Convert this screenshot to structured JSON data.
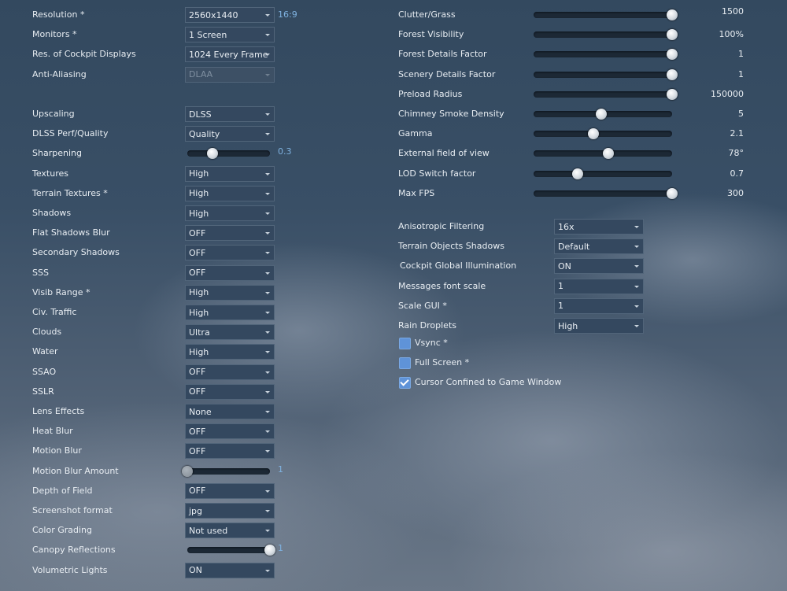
{
  "left": [
    {
      "label": "Resolution *",
      "type": "dropdown",
      "value": "2560x1440",
      "extra": "16:9"
    },
    {
      "label": "Monitors *",
      "type": "dropdown",
      "value": "1 Screen"
    },
    {
      "label": "Res. of Cockpit Displays",
      "type": "dropdown",
      "value": "1024 Every Frame"
    },
    {
      "label": "Anti-Aliasing",
      "type": "dropdown",
      "value": "DLAA",
      "disabled": true
    },
    {
      "type": "spacer"
    },
    {
      "label": "Upscaling",
      "type": "dropdown",
      "value": "DLSS"
    },
    {
      "label": "DLSS Perf/Quality",
      "type": "dropdown",
      "value": "Quality"
    },
    {
      "label": "Sharpening",
      "type": "slider",
      "value": "0.3",
      "fraction": 0.3
    },
    {
      "label": "Textures",
      "type": "dropdown",
      "value": "High"
    },
    {
      "label": "Terrain Textures *",
      "type": "dropdown",
      "value": "High"
    },
    {
      "label": "Shadows",
      "type": "dropdown",
      "value": "High"
    },
    {
      "label": "Flat Shadows Blur",
      "type": "dropdown",
      "value": "OFF"
    },
    {
      "label": "Secondary Shadows",
      "type": "dropdown",
      "value": "OFF"
    },
    {
      "label": "SSS",
      "type": "dropdown",
      "value": "OFF"
    },
    {
      "label": "Visib Range *",
      "type": "dropdown",
      "value": "High"
    },
    {
      "label": "Civ. Traffic",
      "type": "dropdown",
      "value": "High"
    },
    {
      "label": "Clouds",
      "type": "dropdown",
      "value": "Ultra"
    },
    {
      "label": "Water",
      "type": "dropdown",
      "value": "High"
    },
    {
      "label": "SSAO",
      "type": "dropdown",
      "value": "OFF"
    },
    {
      "label": "SSLR",
      "type": "dropdown",
      "value": "OFF"
    },
    {
      "label": "Lens Effects",
      "type": "dropdown",
      "value": "None"
    },
    {
      "label": "Heat Blur",
      "type": "dropdown",
      "value": "OFF"
    },
    {
      "label": "Motion Blur",
      "type": "dropdown",
      "value": "OFF"
    },
    {
      "label": "Motion Blur Amount",
      "type": "slider",
      "value": "1",
      "fraction": 0.0,
      "disabled": true
    },
    {
      "label": "Depth of Field",
      "type": "dropdown",
      "value": "OFF"
    },
    {
      "label": "Screenshot format",
      "type": "dropdown",
      "value": "jpg"
    },
    {
      "label": "Color Grading",
      "type": "dropdown",
      "value": "Not used"
    },
    {
      "label": "Canopy Reflections",
      "type": "slider",
      "value": "1",
      "fraction": 1.0
    },
    {
      "label": "Volumetric Lights",
      "type": "dropdown",
      "value": "ON"
    }
  ],
  "right_sliders": [
    {
      "label": "Clutter/Grass",
      "value": "1500",
      "fraction": 1.0
    },
    {
      "label": "Forest Visibility",
      "value": "100%",
      "fraction": 1.0
    },
    {
      "label": "Forest Details Factor",
      "value": "1",
      "fraction": 1.0
    },
    {
      "label": "Scenery Details Factor",
      "value": "1",
      "fraction": 1.0
    },
    {
      "label": "Preload Radius",
      "value": "150000",
      "fraction": 1.0
    },
    {
      "label": "Chimney Smoke Density",
      "value": "5",
      "fraction": 0.49
    },
    {
      "label": "Gamma",
      "value": "2.1",
      "fraction": 0.43
    },
    {
      "label": "External field of view",
      "value": "78°",
      "fraction": 0.54
    },
    {
      "label": "LOD Switch factor",
      "value": "0.7",
      "fraction": 0.32
    },
    {
      "label": "Max FPS",
      "value": "300",
      "fraction": 1.0
    }
  ],
  "right_dropdowns": [
    {
      "label": "Anisotropic Filtering",
      "value": "16x"
    },
    {
      "label": "Terrain Objects Shadows",
      "value": "Default"
    },
    {
      "label": "Cockpit Global Illumination",
      "value": "ON"
    },
    {
      "label": "Messages font scale",
      "value": "1"
    },
    {
      "label": "Scale GUI *",
      "value": "1"
    },
    {
      "label": "Rain Droplets",
      "value": "High"
    }
  ],
  "checkboxes": [
    {
      "label": "Vsync *",
      "checked": false
    },
    {
      "label": "Full Screen *",
      "checked": false
    },
    {
      "label": "Cursor Confined to Game Window",
      "checked": true
    }
  ]
}
